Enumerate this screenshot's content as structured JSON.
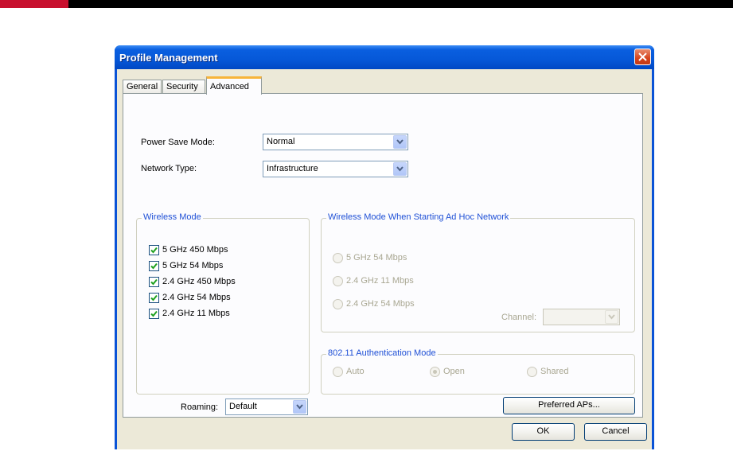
{
  "window": {
    "title": "Profile Management"
  },
  "tabs": [
    {
      "label": "General"
    },
    {
      "label": "Security"
    },
    {
      "label": "Advanced"
    }
  ],
  "power_save": {
    "label": "Power Save Mode:",
    "value": "Normal"
  },
  "network_type": {
    "label": "Network Type:",
    "value": "Infrastructure"
  },
  "wireless_mode": {
    "legend": "Wireless Mode",
    "items": [
      {
        "label": "5 GHz 450 Mbps",
        "checked": true
      },
      {
        "label": "5 GHz 54 Mbps",
        "checked": true
      },
      {
        "label": "2.4 GHz 450 Mbps",
        "checked": true
      },
      {
        "label": "2.4 GHz 54 Mbps",
        "checked": true
      },
      {
        "label": "2.4 GHz 11 Mbps",
        "checked": true
      }
    ]
  },
  "adhoc_mode": {
    "legend": "Wireless Mode When Starting Ad Hoc Network",
    "options": [
      {
        "label": "5 GHz 54 Mbps"
      },
      {
        "label": "2.4 GHz 11 Mbps"
      },
      {
        "label": "2.4 GHz 54 Mbps"
      }
    ],
    "channel_label": "Channel:",
    "channel_value": ""
  },
  "auth_mode": {
    "legend": "802.11 Authentication Mode",
    "options": [
      {
        "label": "Auto",
        "selected": false
      },
      {
        "label": "Open",
        "selected": true
      },
      {
        "label": "Shared",
        "selected": false
      }
    ]
  },
  "roaming": {
    "label": "Roaming:",
    "value": "Default"
  },
  "buttons": {
    "preferred_aps": "Preferred APs...",
    "ok": "OK",
    "cancel": "Cancel"
  },
  "colors": {
    "title_bar": "#0a5fe0",
    "group_legend": "#1f50d6",
    "dialog_background": "#ece9d8",
    "tab_highlight": "#f7b43a",
    "close_button": "#d6441c",
    "page_accent": "#c8102e"
  },
  "icons": {
    "close": "close-icon",
    "dropdown": "chevron-down-icon",
    "check": "checkmark-icon"
  }
}
